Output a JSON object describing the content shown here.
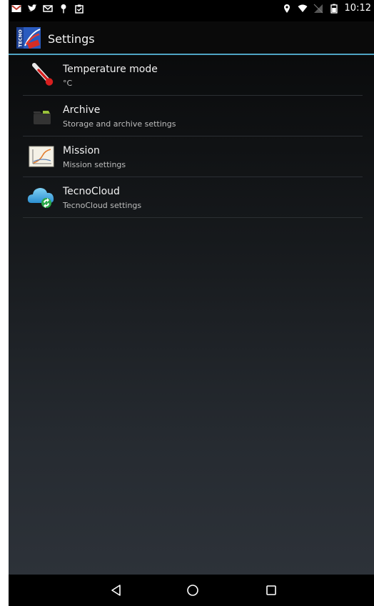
{
  "status_bar": {
    "time": "10:12",
    "left_icons": [
      "gmail-icon",
      "twitter-icon",
      "mail-icon",
      "pin-icon",
      "clipboard-icon"
    ],
    "right_icons": [
      "location-icon",
      "wifi-icon",
      "no-signal-icon",
      "battery-icon"
    ]
  },
  "action_bar": {
    "title": "Settings",
    "logo_icon": "tecno-app-icon",
    "accent_color": "#4ea4c3"
  },
  "settings": {
    "items": [
      {
        "title": "Temperature mode",
        "subtitle": "°C",
        "icon": "thermometer-icon"
      },
      {
        "title": "Archive",
        "subtitle": "Storage and archive settings",
        "icon": "folder-icon"
      },
      {
        "title": "Mission",
        "subtitle": "Mission settings",
        "icon": "chart-icon"
      },
      {
        "title": "TecnoCloud",
        "subtitle": "TecnoCloud settings",
        "icon": "cloud-sync-icon"
      }
    ]
  },
  "nav_bar": {
    "buttons": [
      "back-icon",
      "home-icon",
      "recents-icon"
    ]
  }
}
